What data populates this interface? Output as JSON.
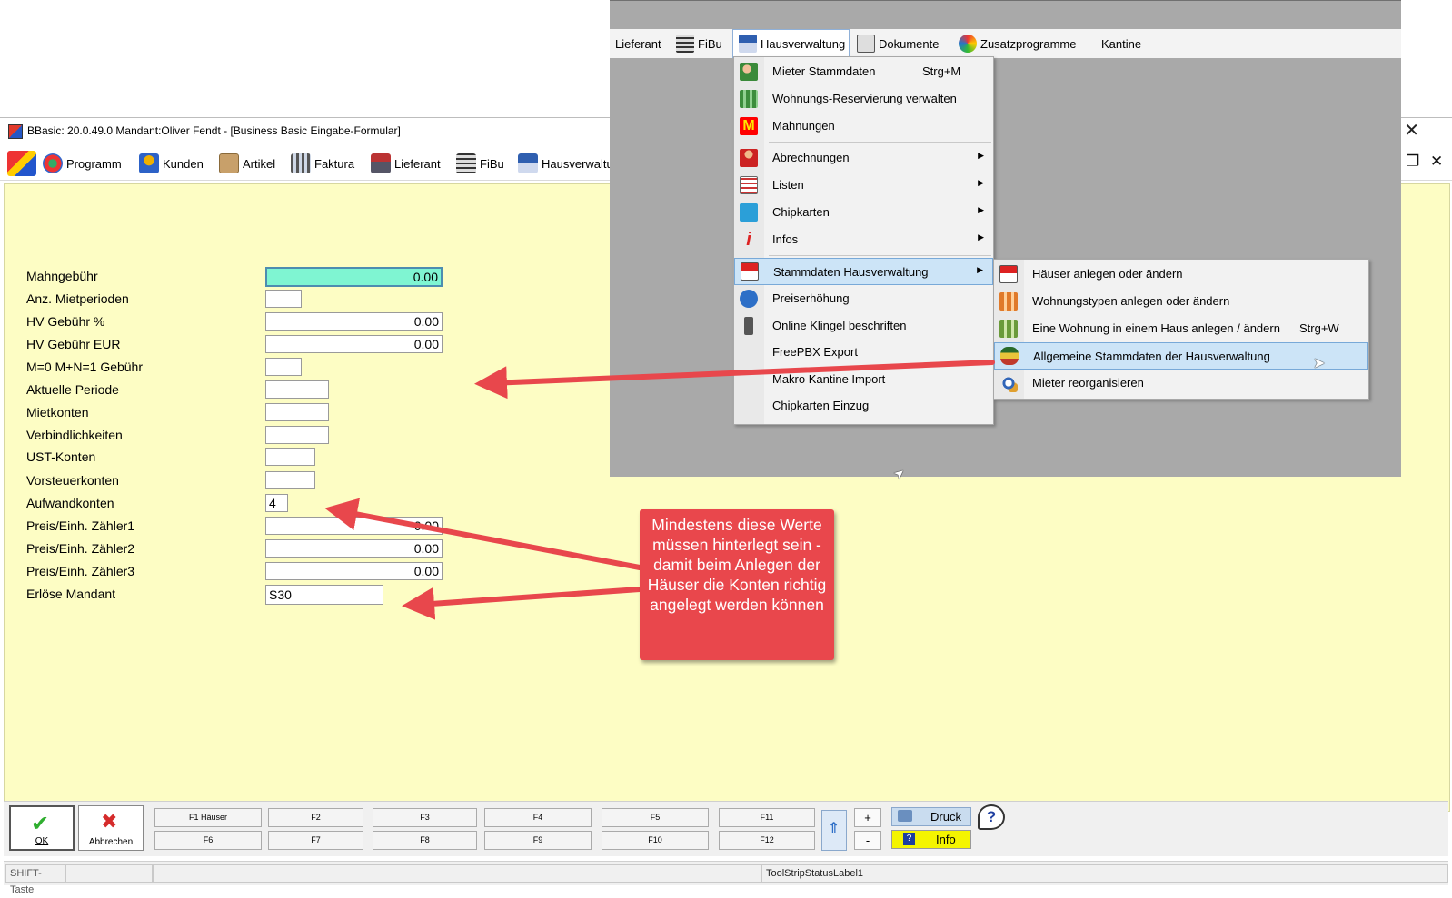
{
  "window": {
    "title": "BBasic: 20.0.49.0 Mandant:Oliver Fendt  - [Business Basic Eingabe-Formular]"
  },
  "toolbar": {
    "items": [
      {
        "label": "Programm",
        "icon": "programm-icon"
      },
      {
        "label": "Kunden",
        "icon": "kunden-icon"
      },
      {
        "label": "Artikel",
        "icon": "artikel-icon"
      },
      {
        "label": "Faktura",
        "icon": "faktura-icon"
      },
      {
        "label": "Lieferant",
        "icon": "lieferant-icon"
      },
      {
        "label": "FiBu",
        "icon": "fibu-icon"
      },
      {
        "label": "Hausverwaltu",
        "icon": "hausverwaltung-icon"
      }
    ]
  },
  "form": {
    "fields": [
      {
        "label": "Mahngebühr",
        "value": "0.00"
      },
      {
        "label": "Anz. Mietperioden",
        "value": ""
      },
      {
        "label": "HV Gebühr %",
        "value": "0.00"
      },
      {
        "label": "HV Gebühr EUR",
        "value": "0.00"
      },
      {
        "label": "M=0 M+N=1 Gebühr",
        "value": ""
      },
      {
        "label": "Aktuelle Periode",
        "value": ""
      },
      {
        "label": "Mietkonten",
        "value": ""
      },
      {
        "label": "Verbindlichkeiten",
        "value": ""
      },
      {
        "label": "UST-Konten",
        "value": ""
      },
      {
        "label": "Vorsteuerkonten",
        "value": ""
      },
      {
        "label": "Aufwandkonten",
        "value": "4"
      },
      {
        "label": "Preis/Einh. Zähler1",
        "value": "0.00"
      },
      {
        "label": "Preis/Einh. Zähler2",
        "value": "0.00"
      },
      {
        "label": "Preis/Einh. Zähler3",
        "value": "0.00"
      },
      {
        "label": "Erlöse Mandant",
        "value": "S30"
      }
    ]
  },
  "buttons": {
    "ok": "OK",
    "cancel": "Abbrechen",
    "fkeys_top": [
      "F1 Häuser",
      "F2",
      "F3",
      "F4",
      "F5",
      "F11"
    ],
    "fkeys_bottom": [
      "F6",
      "F7",
      "F8",
      "F9",
      "F10",
      "F12"
    ],
    "plus": "+",
    "minus": "-",
    "druck": "Druck",
    "info": "Info"
  },
  "status": {
    "shift": "SHIFT-Taste",
    "label": "ToolStripStatusLabel1"
  },
  "overlay": {
    "menubar": [
      {
        "label": "Lieferant"
      },
      {
        "label": "FiBu",
        "icon": "fibu-icon"
      },
      {
        "label": "Hausverwaltung",
        "icon": "house-icon"
      },
      {
        "label": "Dokumente",
        "icon": "dokumente-icon"
      },
      {
        "label": "Zusatzprogramme",
        "icon": "zusatz-icon"
      },
      {
        "label": "Kantine"
      }
    ],
    "menu": [
      {
        "label": "Mieter Stammdaten",
        "shortcut": "Strg+M"
      },
      {
        "label": "Wohnungs-Reservierung verwalten"
      },
      {
        "label": "Mahnungen"
      },
      {
        "label": "Abrechnungen"
      },
      {
        "label": "Listen"
      },
      {
        "label": "Chipkarten"
      },
      {
        "label": "Infos"
      },
      {
        "label": "Stammdaten Hausverwaltung"
      },
      {
        "label": "Preiserhöhung"
      },
      {
        "label": "Online Klingel beschriften"
      },
      {
        "label": "FreePBX Export"
      },
      {
        "label": "Makro Kantine Import"
      },
      {
        "label": "Chipkarten Einzug"
      }
    ],
    "submenu": [
      {
        "label": "Häuser anlegen oder ändern"
      },
      {
        "label": "Wohnungstypen anlegen oder ändern"
      },
      {
        "label": "Eine Wohnung in einem Haus anlegen / ändern",
        "shortcut": "Strg+W"
      },
      {
        "label": "Allgemeine Stammdaten der Hausverwaltung"
      },
      {
        "label": "Mieter reorganisieren"
      }
    ]
  },
  "annotation": {
    "text": "Mindestens diese Werte müssen hinterlegt sein - damit beim Anlegen der Häuser die Konten richtig angelegt werden können"
  },
  "colors": {
    "form_bg": "#fdfdc4",
    "active_field": "#7ff5d2",
    "highlight": "#cce4f7",
    "callout": "#e9474c",
    "arrow": "#e8474c"
  }
}
